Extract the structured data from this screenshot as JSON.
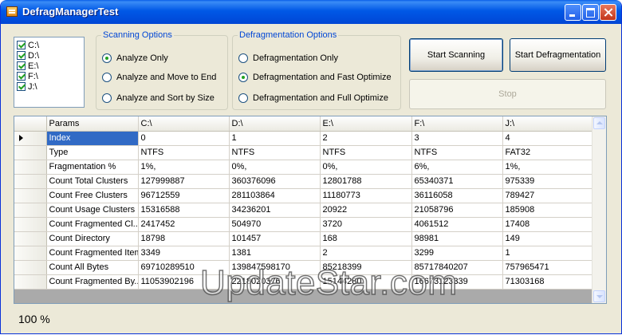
{
  "window": {
    "title": "DefragManagerTest"
  },
  "drives": [
    {
      "label": "C:\\",
      "checked": true
    },
    {
      "label": "D:\\",
      "checked": true
    },
    {
      "label": "E:\\",
      "checked": true
    },
    {
      "label": "F:\\",
      "checked": true
    },
    {
      "label": "J:\\",
      "checked": true
    }
  ],
  "scanning": {
    "legend": "Scanning Options",
    "options": [
      {
        "label": "Analyze Only",
        "selected": true
      },
      {
        "label": "Analyze and Move to End",
        "selected": false
      },
      {
        "label": "Analyze and Sort by Size",
        "selected": false
      }
    ]
  },
  "defrag": {
    "legend": "Defragmentation Options",
    "options": [
      {
        "label": "Defragmentation Only",
        "selected": false
      },
      {
        "label": "Defragmentation and Fast Optimize",
        "selected": true
      },
      {
        "label": "Defragmentation and Full Optimize",
        "selected": false
      }
    ]
  },
  "buttons": {
    "start_scanning": "Start Scanning",
    "start_defrag": "Start Defragmentation",
    "stop": "Stop"
  },
  "grid": {
    "columns": [
      "Params",
      "C:\\",
      "D:\\",
      "E:\\",
      "F:\\",
      "J:\\"
    ],
    "rows": [
      [
        "Index",
        "0",
        "1",
        "2",
        "3",
        "4"
      ],
      [
        "Type",
        "NTFS",
        "NTFS",
        "NTFS",
        "NTFS",
        "FAT32"
      ],
      [
        "Fragmentation %",
        "1%,",
        "0%,",
        "0%,",
        "6%,",
        "1%,"
      ],
      [
        "Count Total Clusters",
        "127999887",
        "360376096",
        "12801788",
        "65340371",
        "975339"
      ],
      [
        "Count Free Clusters",
        "96712559",
        "281103864",
        "11180773",
        "36116058",
        "789427"
      ],
      [
        "Count Usage Clusters",
        "15316588",
        "34236201",
        "20922",
        "21058796",
        "185908"
      ],
      [
        "Count Fragmented Cl...",
        "2417452",
        "504970",
        "3720",
        "4061512",
        "17408"
      ],
      [
        "Count Directory",
        "18798",
        "101457",
        "168",
        "98981",
        "149"
      ],
      [
        "Count Fragmented Item",
        "3349",
        "1381",
        "2",
        "3299",
        "1"
      ],
      [
        "Count All Bytes",
        "69710289510",
        "139847598170",
        "85218399",
        "85717840207",
        "757965471"
      ],
      [
        "Count Fragmented By...",
        "11053902196",
        "2218020376",
        "15144280",
        "16673123339",
        "71303168"
      ]
    ]
  },
  "status": {
    "zoom": "100 %"
  },
  "watermark": "UpdateStar.com"
}
